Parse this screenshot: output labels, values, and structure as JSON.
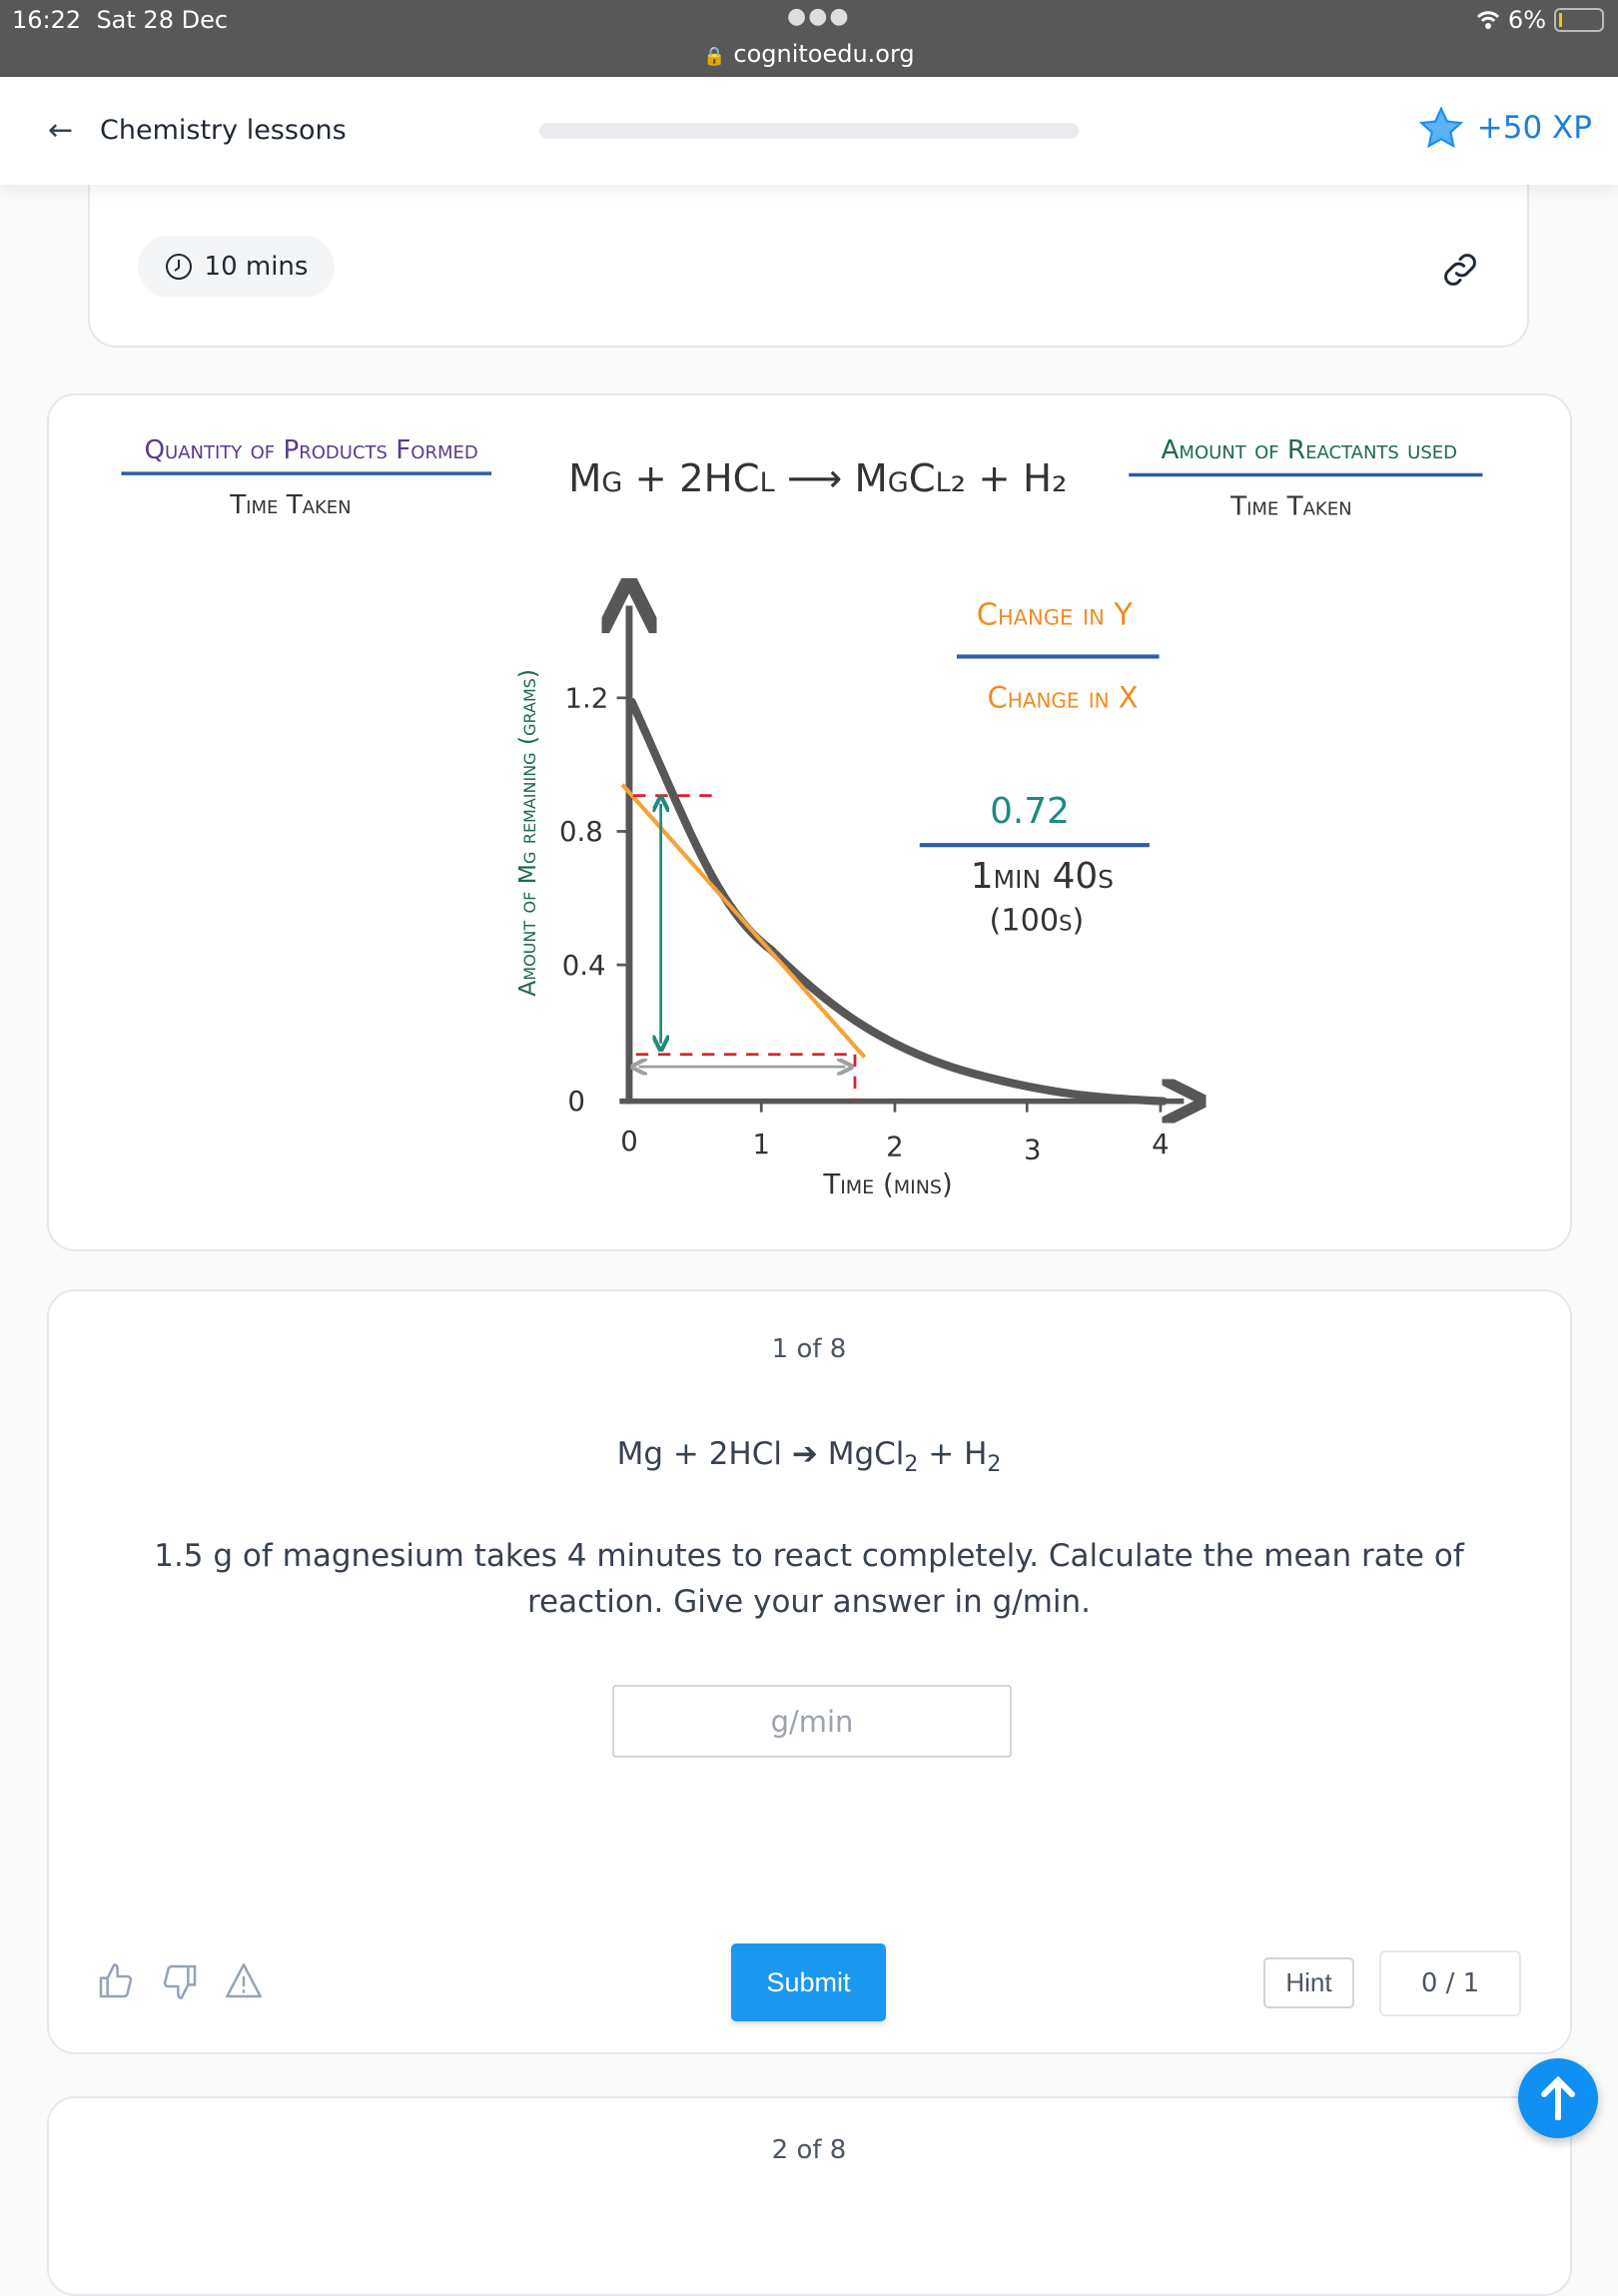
{
  "status_bar": {
    "time": "16:22",
    "date": "Sat 28 Dec",
    "url": "cognitoedu.org",
    "battery": "6%",
    "icons": [
      "wifi-icon",
      "battery-icon",
      "lock-icon"
    ]
  },
  "header": {
    "back_label": "Chemistry lessons",
    "xp": "+50 XP",
    "progress": 0,
    "colors": {
      "xp": "#1d7fd8"
    }
  },
  "lesson_info": {
    "duration": "10 mins"
  },
  "diagram": {
    "left_formula": {
      "numerator": "Quantity of Products Formed",
      "denominator": "Time Taken"
    },
    "equation": "Mg + 2HCl ⟶ MgCl₂ + H₂",
    "right_formula": {
      "numerator": "Amount of Reactants used",
      "denominator": "Time Taken"
    },
    "gradient": {
      "numerator": "Change in Y",
      "denominator": "Change in X",
      "value_numerator": "0.72",
      "value_denominator": "1min 40s",
      "value_denominator_alt": "(100s)"
    },
    "y_axis_label": "Amount of Mg remaining (grams)",
    "x_axis_label": "Time (mins)",
    "y_ticks": [
      "0",
      "0.4",
      "0.8",
      "1.2"
    ],
    "x_ticks": [
      "0",
      "1",
      "2",
      "3",
      "4"
    ],
    "colors": {
      "curve": "#575757",
      "tangent": "#f7a13a",
      "dashes": "#d4232b",
      "change_y": "#1f8a80",
      "change_x": "#a0a0a0",
      "purple": "#5b3a8c",
      "green": "#1c6b4a",
      "blue": "#2a5ea8",
      "orange": "#f28b20"
    }
  },
  "question": {
    "counter": "1 of 8",
    "equation": {
      "left": "Mg + 2HCl ",
      "arrow": "➔",
      "p1": " MgCl",
      "p1_sub": "2",
      "p2": " + H",
      "p2_sub": "2"
    },
    "text": "1.5 g of magnesium takes 4 minutes to react completely. Calculate the mean rate of reaction. Give your answer in g/min.",
    "answer_value": "",
    "answer_placeholder": "g/min",
    "submit_label": "Submit",
    "hint_label": "Hint",
    "score": "0 / 1",
    "feedback_icons": [
      "thumbs-up-icon",
      "thumbs-down-icon",
      "warning-icon"
    ]
  },
  "next_question": {
    "counter": "2 of 8"
  },
  "colors": {
    "accent": "#1a98f0"
  }
}
